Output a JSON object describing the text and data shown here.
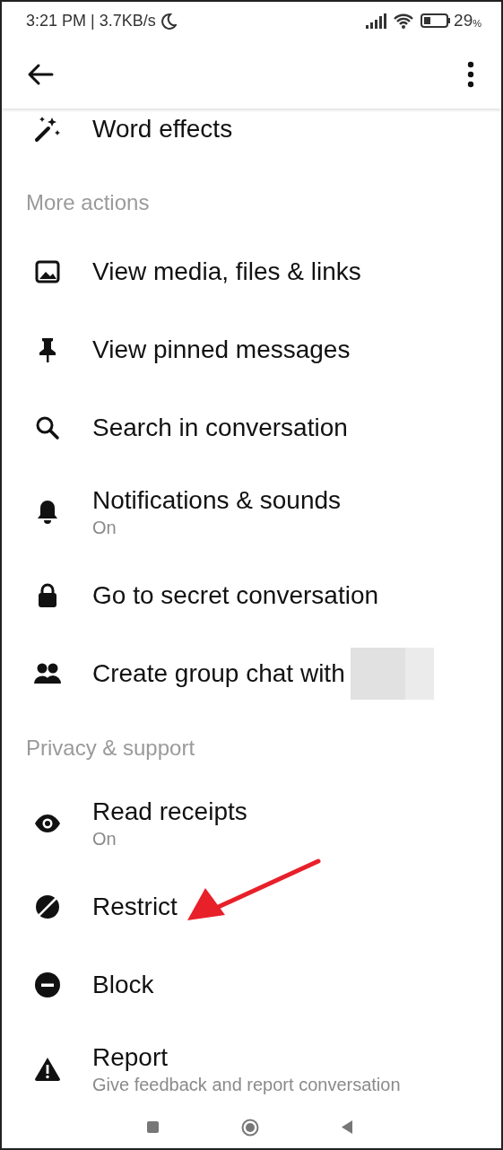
{
  "status_bar": {
    "time_speed": "3:21 PM | 3.7KB/s",
    "battery_percent": "29",
    "battery_unit": "%"
  },
  "sections": [
    {
      "items": [
        {
          "title": "Word effects"
        }
      ]
    },
    {
      "header": "More actions",
      "items": [
        {
          "title": "View media, files & links"
        },
        {
          "title": "View pinned messages"
        },
        {
          "title": "Search in conversation"
        },
        {
          "title": "Notifications & sounds",
          "subtitle": "On"
        },
        {
          "title": "Go to secret conversation"
        },
        {
          "title": "Create group chat with",
          "redacted": true
        }
      ]
    },
    {
      "header": "Privacy & support",
      "items": [
        {
          "title": "Read receipts",
          "subtitle": "On"
        },
        {
          "title": "Restrict"
        },
        {
          "title": "Block"
        },
        {
          "title": "Report",
          "subtitle": "Give feedback and report conversation"
        }
      ]
    }
  ]
}
